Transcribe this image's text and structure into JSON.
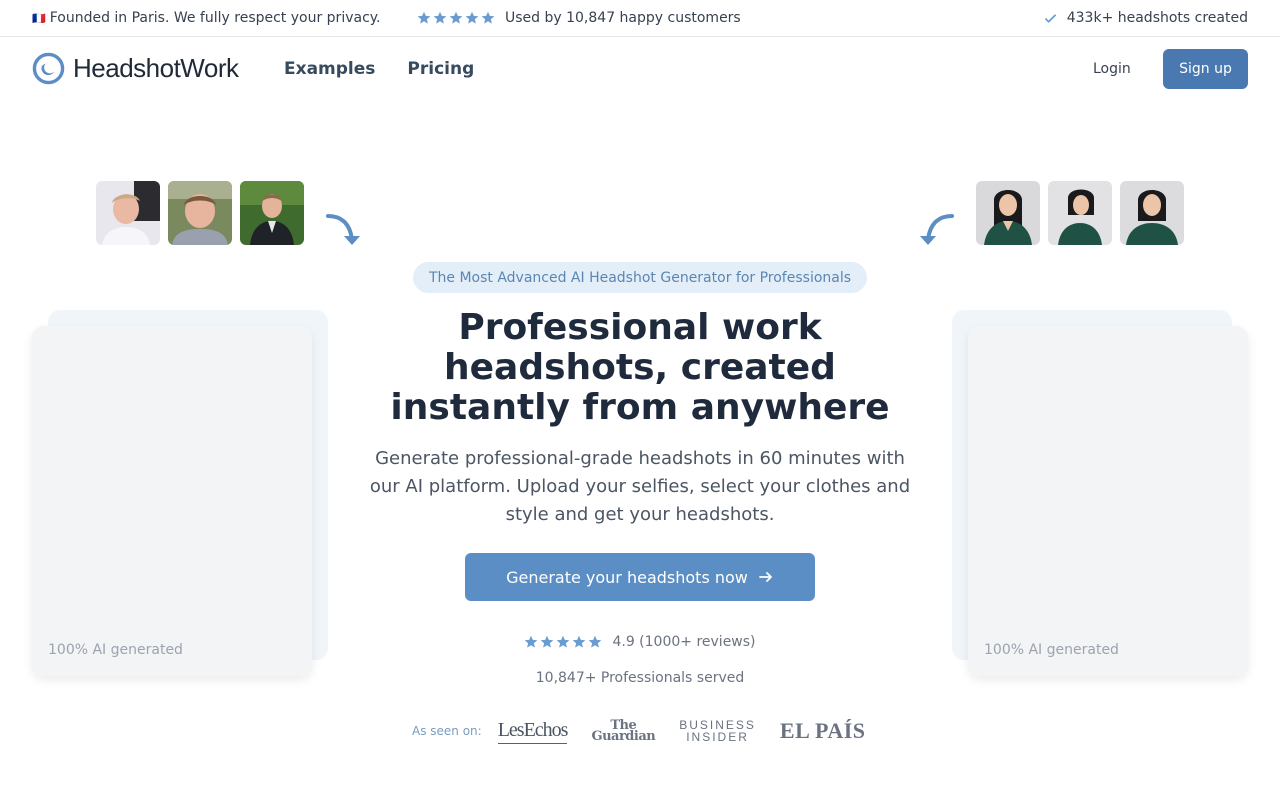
{
  "topbar": {
    "flag": "🇫🇷",
    "founded_text": "Founded in Paris. We fully respect your privacy.",
    "customers_text": "Used by 10,847 happy customers",
    "star_rating": 5,
    "headshots_text": "433k+ headshots created"
  },
  "header": {
    "logo_text": "HeadshotWork",
    "nav": [
      "Examples",
      "Pricing"
    ],
    "login_label": "Login",
    "signup_label": "Sign up"
  },
  "hero": {
    "badge": "The Most Advanced AI Headshot Generator for Professionals",
    "title": "Professional work headshots, created instantly from anywhere",
    "subtitle": "Generate professional-grade headshots in 60 minutes with our AI platform. Upload your selfies, select your clothes and style and get your headshots.",
    "cta_label": "Generate your headshots now",
    "review_rating": 5,
    "reviews_text": "4.9 (1000+ reviews)",
    "served_text": "10,847+ Professionals served",
    "seen_on_label": "As seen on:",
    "press": [
      "Les Echos",
      "The Guardian",
      "BUSINESS INSIDER",
      "EL PAÍS"
    ]
  },
  "cards": {
    "left_caption": "100% AI generated",
    "right_caption": "100% AI generated"
  },
  "colors": {
    "accent": "#4a78b0",
    "cta": "#5b8ec4",
    "star": "#6a9bd1",
    "badge_bg": "#e3eef8"
  }
}
